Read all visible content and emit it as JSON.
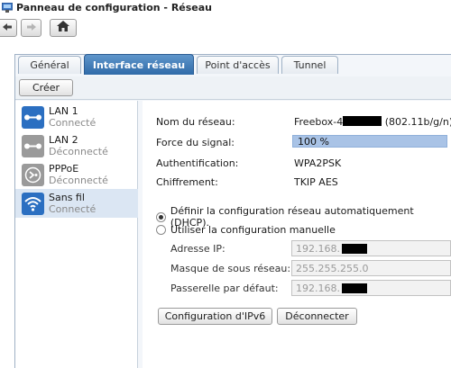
{
  "window": {
    "title": "Panneau de configuration - Réseau"
  },
  "nav": {
    "back_icon": "arrow-left",
    "forward_icon": "arrow-right",
    "home_icon": "home"
  },
  "tabs": [
    {
      "label": "Général",
      "active": false
    },
    {
      "label": "Interface réseau",
      "active": true
    },
    {
      "label": "Point d'accès",
      "active": false
    },
    {
      "label": "Tunnel",
      "active": false
    }
  ],
  "toolbar": {
    "create_label": "Créer"
  },
  "interfaces": [
    {
      "name": "LAN 1",
      "status": "Connecté",
      "icon": "ethernet-icon",
      "color": "#2b6fc1"
    },
    {
      "name": "LAN 2",
      "status": "Déconnecté",
      "icon": "ethernet-icon",
      "color": "#9a9a9a"
    },
    {
      "name": "PPPoE",
      "status": "Déconnecté",
      "icon": "pppoe-icon",
      "color": "#9a9a9a"
    },
    {
      "name": "Sans fil",
      "status": "Connecté",
      "icon": "wifi-icon",
      "color": "#2b6fc1",
      "selected": true
    }
  ],
  "details": {
    "network_name_label": "Nom du réseau:",
    "network_name_prefix": "Freebox-4",
    "network_name_suffix": "(802.11b/g/n)",
    "signal_label": "Force du signal:",
    "signal_value": "100 %",
    "signal_level": 1.0,
    "auth_label": "Authentification:",
    "auth_value": "WPA2PSK",
    "enc_label": "Chiffrement:",
    "enc_value": "TKIP AES"
  },
  "config": {
    "dhcp_label": "Définir la configuration réseau automatiquement (DHCP).",
    "manual_label": "Utiliser la configuration manuelle",
    "selected": "dhcp"
  },
  "fields": {
    "ip_label": "Adresse IP:",
    "ip_value": "192.168.",
    "mask_label": "Masque de sous réseau:",
    "mask_value": "255.255.255.0",
    "gateway_label": "Passerelle par défaut:",
    "gateway_value": "192.168."
  },
  "actions": {
    "ipv6_label": "Configuration d'IPv6",
    "disconnect_label": "Déconnecter"
  }
}
